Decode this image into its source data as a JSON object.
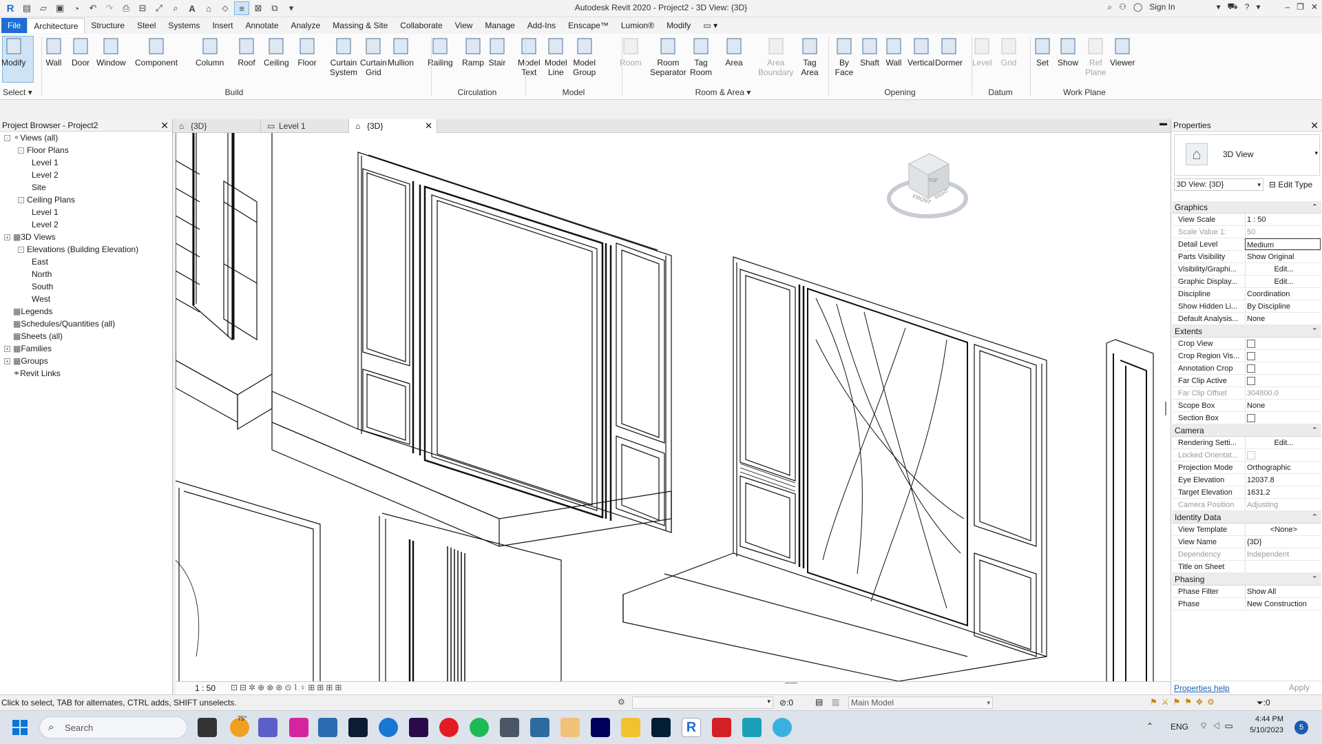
{
  "app": {
    "title": "Autodesk Revit 2020 - Project2 - 3D View: {3D}",
    "sign_in": "Sign In"
  },
  "menu": [
    "File",
    "Architecture",
    "Structure",
    "Steel",
    "Systems",
    "Insert",
    "Annotate",
    "Analyze",
    "Massing & Site",
    "Collaborate",
    "View",
    "Manage",
    "Add-Ins",
    "Enscape™",
    "Lumion®",
    "Modify"
  ],
  "ribbon": {
    "select_label": "Select",
    "tools": [
      {
        "id": "modify",
        "label": "Modify"
      },
      {
        "id": "wall",
        "label": "Wall"
      },
      {
        "id": "door",
        "label": "Door"
      },
      {
        "id": "window",
        "label": "Window"
      },
      {
        "id": "component",
        "label": "Component"
      },
      {
        "id": "column",
        "label": "Column"
      },
      {
        "id": "roof",
        "label": "Roof"
      },
      {
        "id": "ceiling",
        "label": "Ceiling"
      },
      {
        "id": "floor",
        "label": "Floor"
      },
      {
        "id": "curtain-system",
        "label": "Curtain\nSystem"
      },
      {
        "id": "curtain-grid",
        "label": "Curtain\nGrid"
      },
      {
        "id": "mullion",
        "label": "Mullion"
      },
      {
        "id": "railing",
        "label": "Railing"
      },
      {
        "id": "ramp",
        "label": "Ramp"
      },
      {
        "id": "stair",
        "label": "Stair"
      },
      {
        "id": "model-text",
        "label": "Model\nText"
      },
      {
        "id": "model-line",
        "label": "Model\nLine"
      },
      {
        "id": "model-group",
        "label": "Model\nGroup"
      },
      {
        "id": "room",
        "label": "Room"
      },
      {
        "id": "room-separator",
        "label": "Room\nSeparator"
      },
      {
        "id": "tag-room",
        "label": "Tag\nRoom"
      },
      {
        "id": "area",
        "label": "Area"
      },
      {
        "id": "area-boundary",
        "label": "Area\nBoundary"
      },
      {
        "id": "tag-area",
        "label": "Tag\nArea"
      },
      {
        "id": "by-face",
        "label": "By\nFace"
      },
      {
        "id": "shaft",
        "label": "Shaft"
      },
      {
        "id": "opening-wall",
        "label": "Wall"
      },
      {
        "id": "vertical",
        "label": "Vertical"
      },
      {
        "id": "dormer",
        "label": "Dormer"
      },
      {
        "id": "level",
        "label": "Level"
      },
      {
        "id": "grid",
        "label": "Grid"
      },
      {
        "id": "set",
        "label": "Set"
      },
      {
        "id": "show",
        "label": "Show"
      },
      {
        "id": "ref-plane",
        "label": "Ref\nPlane"
      },
      {
        "id": "viewer",
        "label": "Viewer"
      }
    ],
    "groups": [
      "Build",
      "Circulation",
      "Model",
      "Room & Area",
      "Opening",
      "Datum",
      "Work Plane"
    ]
  },
  "project_browser": {
    "title": "Project Browser - Project2",
    "items": [
      "Views (all)",
      "Floor Plans",
      "Level 1",
      "Level 2",
      "Site",
      "Ceiling Plans",
      "Level 1",
      "Level 2",
      "3D Views",
      "Elevations (Building Elevation)",
      "East",
      "North",
      "South",
      "West",
      "Legends",
      "Schedules/Quantities (all)",
      "Sheets (all)",
      "Families",
      "Groups",
      "Revit Links"
    ]
  },
  "view_tabs": [
    "{3D}",
    "Level 1",
    "{3D}"
  ],
  "view_bar": {
    "scale": "1 : 50"
  },
  "properties": {
    "title": "Properties",
    "type_name": "3D View",
    "selector": "3D View: {3D}",
    "edit_type": "Edit Type",
    "sections": [
      {
        "name": "Graphics",
        "rows": [
          [
            "View Scale",
            "1 : 50"
          ],
          [
            "Scale Value    1:",
            "50"
          ],
          [
            "Detail Level",
            "Medium"
          ],
          [
            "Parts Visibility",
            "Show Original"
          ],
          [
            "Visibility/Graphi...",
            "Edit..."
          ],
          [
            "Graphic Display...",
            "Edit..."
          ],
          [
            "Discipline",
            "Coordination"
          ],
          [
            "Show Hidden Li...",
            "By Discipline"
          ],
          [
            "Default Analysis...",
            "None"
          ]
        ]
      },
      {
        "name": "Extents",
        "rows": [
          [
            "Crop View",
            ""
          ],
          [
            "Crop Region Vis...",
            ""
          ],
          [
            "Annotation Crop",
            ""
          ],
          [
            "Far Clip Active",
            ""
          ],
          [
            "Far Clip Offset",
            "304800.0"
          ],
          [
            "Scope Box",
            "None"
          ],
          [
            "Section Box",
            ""
          ]
        ]
      },
      {
        "name": "Camera",
        "rows": [
          [
            "Rendering Setti...",
            "Edit..."
          ],
          [
            "Locked Orientat...",
            ""
          ],
          [
            "Projection Mode",
            "Orthographic"
          ],
          [
            "Eye Elevation",
            "12037.8"
          ],
          [
            "Target Elevation",
            "1631.2"
          ],
          [
            "Camera Position",
            "Adjusting"
          ]
        ]
      },
      {
        "name": "Identity Data",
        "rows": [
          [
            "View Template",
            "<None>"
          ],
          [
            "View Name",
            "{3D}"
          ],
          [
            "Dependency",
            "Independent"
          ],
          [
            "Title on Sheet",
            ""
          ]
        ]
      },
      {
        "name": "Phasing",
        "rows": [
          [
            "Phase Filter",
            "Show All"
          ],
          [
            "Phase",
            "New Construction"
          ]
        ]
      }
    ],
    "help": "Properties help",
    "apply": "Apply"
  },
  "status": {
    "hint": "Click to select, TAB for alternates, CTRL adds, SHIFT unselects.",
    "count": ":0",
    "model": "Main Model",
    "filter": ":0"
  },
  "taskbar": {
    "search": "Search",
    "weather": "75°",
    "lang": "ENG",
    "time": "4:44 PM",
    "date": "5/10/2023",
    "badge": "5"
  },
  "viewcube": {
    "top": "TOP",
    "front": "FRONT",
    "right": "RIGHT"
  }
}
